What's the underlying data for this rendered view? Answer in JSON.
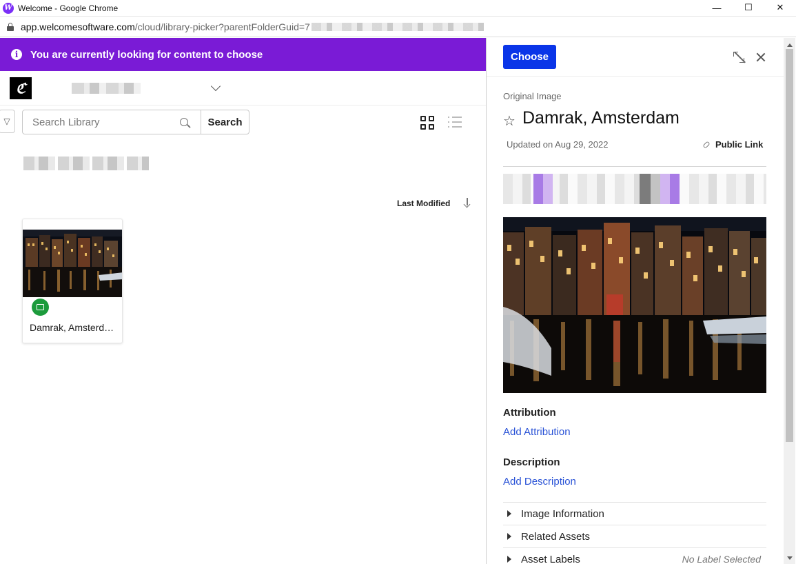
{
  "window": {
    "title": "Welcome - Google Chrome",
    "app_icon": "W",
    "minimize": "—",
    "maximize": "☐",
    "close": "✕"
  },
  "address_bar": {
    "host": "app.welcomesoftware.com",
    "path": "/cloud/library-picker?parentFolderGuid=7"
  },
  "banner": {
    "text": "You are currently looking for content to choose",
    "icon": "info-icon"
  },
  "org": {
    "logo_glyph": "ℭ",
    "dropdown_icon": "chevron-down-icon"
  },
  "search": {
    "placeholder": "Search Library",
    "button_label": "Search",
    "filter_glyph": "▽"
  },
  "sort": {
    "label": "Last Modified"
  },
  "cards": [
    {
      "title": "Damrak, Amsterdam",
      "type_icon": "image-icon"
    }
  ],
  "detail": {
    "choose_label": "Choose",
    "asset_type": "Original Image",
    "star_glyph": "☆",
    "title": "Damrak, Amsterdam",
    "updated": "Updated on Aug 29, 2022",
    "public_link": "Public Link",
    "attribution_heading": "Attribution",
    "attribution_action": "Add Attribution",
    "description_heading": "Description",
    "description_action": "Add Description",
    "accordion": [
      {
        "label": "Image Information",
        "value": ""
      },
      {
        "label": "Related Assets",
        "value": ""
      },
      {
        "label": "Asset Labels",
        "value": "No Label Selected"
      }
    ]
  },
  "colors": {
    "banner": "#7a1bd6",
    "primary_button": "#0a35e8",
    "link": "#2952d6",
    "badge": "#1c9b3c"
  }
}
